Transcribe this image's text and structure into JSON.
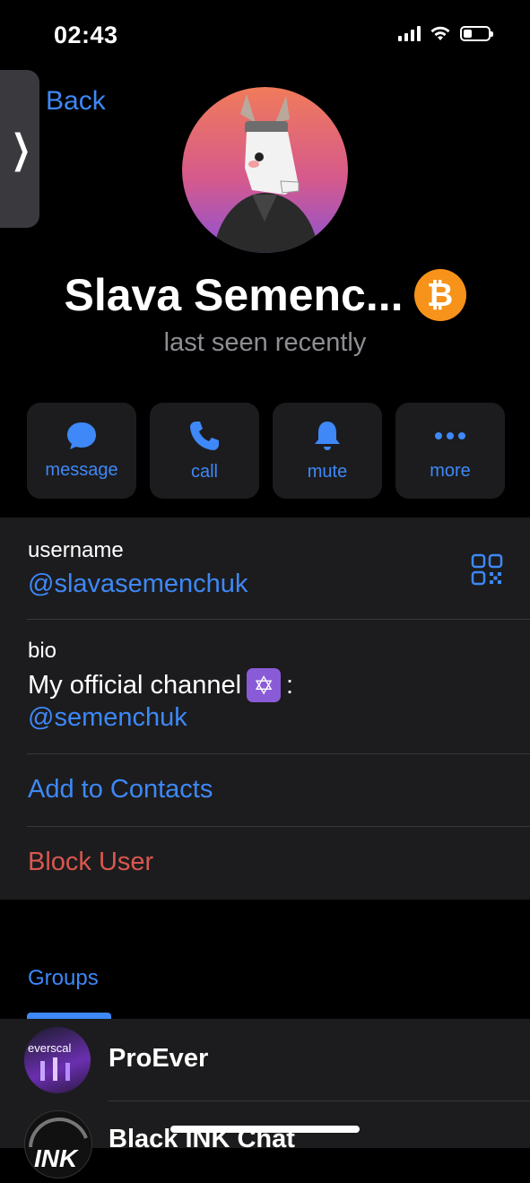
{
  "status_bar": {
    "time": "02:43",
    "battery_level": 0.35
  },
  "nav": {
    "back_label": "Back"
  },
  "profile": {
    "name": "Slava Semenc...",
    "status": "last seen recently",
    "emoji_status": "bitcoin-icon"
  },
  "actions": [
    {
      "label": "message",
      "icon": "chat-bubble-icon"
    },
    {
      "label": "call",
      "icon": "phone-icon"
    },
    {
      "label": "mute",
      "icon": "bell-icon"
    },
    {
      "label": "more",
      "icon": "ellipsis-icon"
    }
  ],
  "info": {
    "username_label": "username",
    "username": "@slavasemenchuk",
    "bio_label": "bio",
    "bio_text": "My official channel",
    "bio_suffix": ":",
    "bio_link": "@semenchuk",
    "add_contact": "Add to Contacts",
    "block_user": "Block User"
  },
  "groups": {
    "title": "Groups",
    "items": [
      {
        "name": "ProEver",
        "avatar_text": "everscal"
      },
      {
        "name": "Black INK Chat",
        "avatar_text": "INK"
      }
    ]
  },
  "colors": {
    "accent": "#3e88f7",
    "destructive": "#d9574f",
    "panel": "#1c1c1e"
  }
}
